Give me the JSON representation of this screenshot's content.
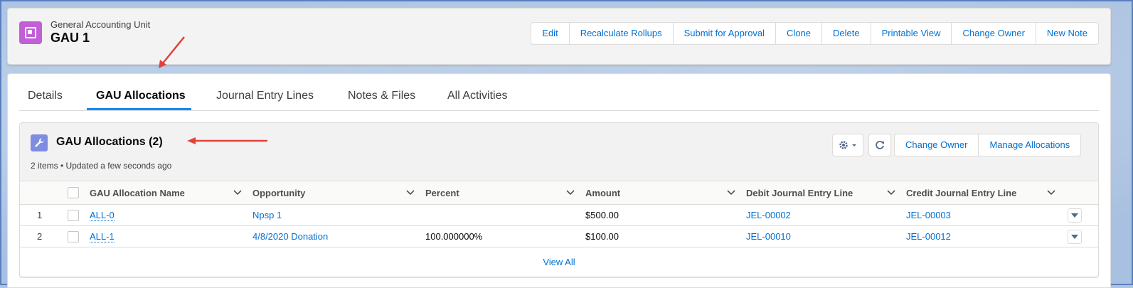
{
  "header": {
    "object_kind": "General Accounting Unit",
    "record_name": "GAU 1",
    "actions": [
      "Edit",
      "Recalculate Rollups",
      "Submit for Approval",
      "Clone",
      "Delete",
      "Printable View",
      "Change Owner",
      "New Note"
    ]
  },
  "tabs": [
    "Details",
    "GAU Allocations",
    "Journal Entry Lines",
    "Notes & Files",
    "All Activities"
  ],
  "active_tab": "GAU Allocations",
  "related_list": {
    "title": "GAU Allocations (2)",
    "subtitle": "2 items • Updated a few seconds ago",
    "icon": "wrench-icon",
    "buttons": [
      "Change Owner",
      "Manage Allocations"
    ],
    "columns": [
      "GAU Allocation Name",
      "Opportunity",
      "Percent",
      "Amount",
      "Debit Journal Entry Line",
      "Credit Journal Entry Line"
    ],
    "rows": [
      {
        "num": "1",
        "name": "ALL-0",
        "opportunity": "Npsp 1",
        "percent": "",
        "amount": "$500.00",
        "debit": "JEL-00002",
        "credit": "JEL-00003"
      },
      {
        "num": "2",
        "name": "ALL-1",
        "opportunity": "4/8/2020 Donation",
        "percent": "100.000000%",
        "amount": "$100.00",
        "debit": "JEL-00010",
        "credit": "JEL-00012"
      }
    ],
    "view_all": "View All"
  },
  "colors": {
    "link": "#0070d2",
    "record_icon": "#c15fd6",
    "related_icon": "#7f8de1",
    "active_tab_underline": "#1589ee",
    "annotation_arrow": "#e0433b"
  }
}
